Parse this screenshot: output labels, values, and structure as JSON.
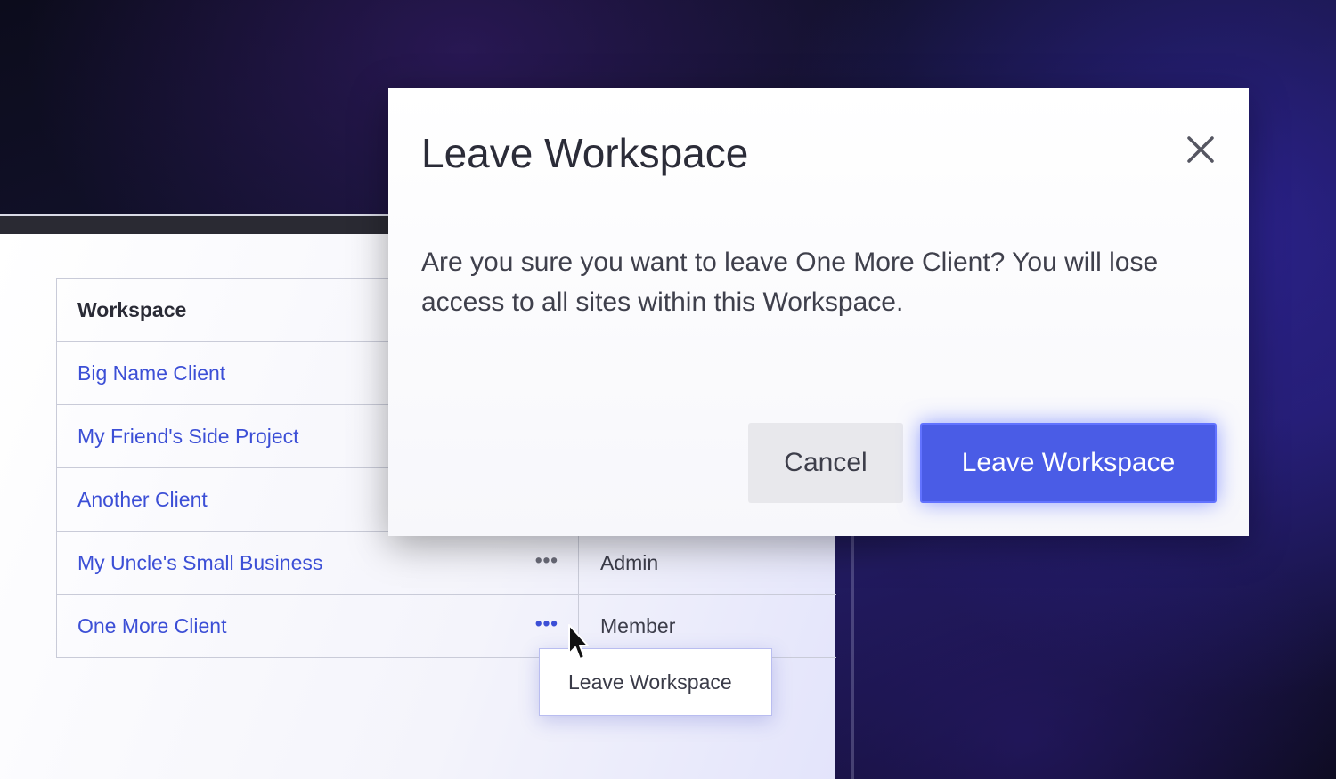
{
  "table": {
    "header": "Workspace",
    "rows": [
      {
        "name": "Big Name Client",
        "role": ""
      },
      {
        "name": "My Friend's Side Project",
        "role": ""
      },
      {
        "name": "Another Client",
        "role": ""
      },
      {
        "name": "My Uncle's Small Business",
        "role": "Admin",
        "more": "•••"
      },
      {
        "name": "One More Client",
        "role": "Member",
        "more": "•••"
      }
    ]
  },
  "context_menu": {
    "item": "Leave Workspace"
  },
  "modal": {
    "title": "Leave Workspace",
    "body": "Are you sure you want to leave One More Client? You will lose access to all sites within this Workspace.",
    "cancel_label": "Cancel",
    "confirm_label": "Leave Workspace",
    "close_icon": "close-icon"
  },
  "colors": {
    "accent": "#4a5ce6",
    "link": "#3c4fd6",
    "background_dark": "#151433"
  }
}
